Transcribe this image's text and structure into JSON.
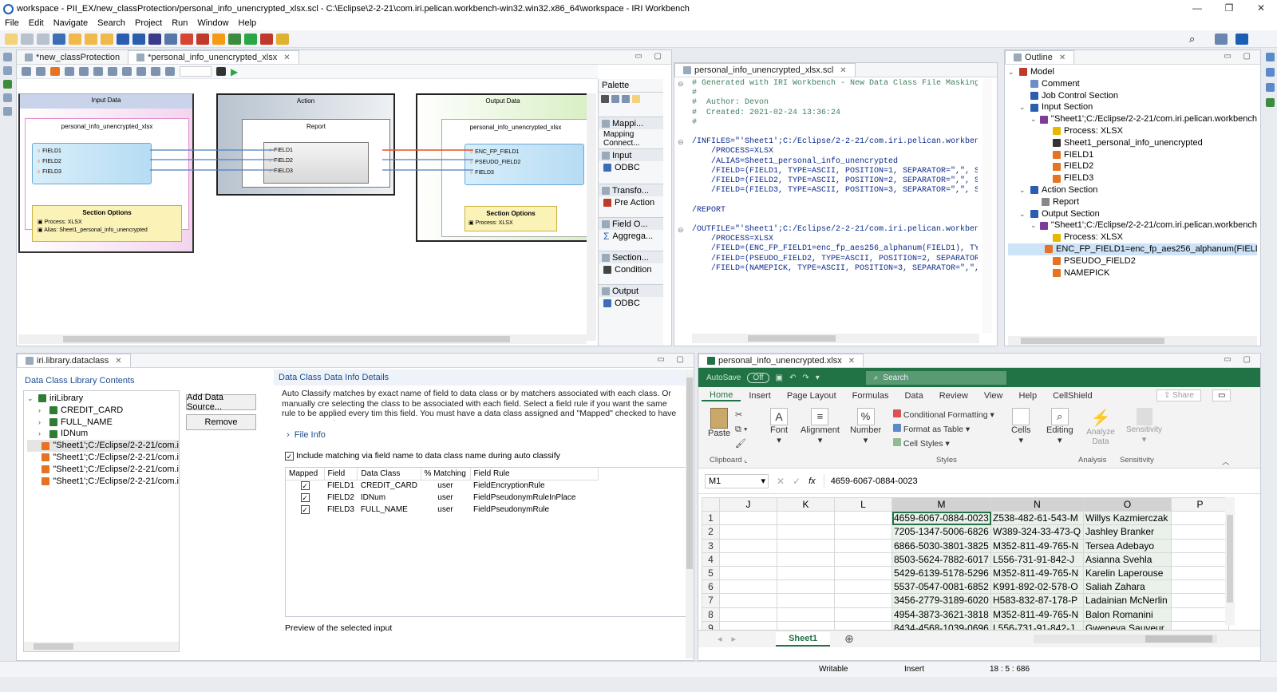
{
  "window": {
    "title": "workspace - PII_EX/new_classProtection/personal_info_unencrypted_xlsx.scl - C:\\Eclipse\\2-2-21\\com.iri.pelican.workbench-win32.win32.x86_64\\workspace - IRI Workbench",
    "minimize": "—",
    "restore": "❐",
    "close": "✕"
  },
  "menu": [
    "File",
    "Edit",
    "Navigate",
    "Search",
    "Project",
    "Run",
    "Window",
    "Help"
  ],
  "diagram": {
    "tabs": [
      "*new_classProtection",
      "*personal_info_unencrypted_xlsx"
    ],
    "input": {
      "header": "Input Data",
      "file": "personal_info_unencrypted_xlsx",
      "fields": [
        "FIELD1",
        "FIELD2",
        "FIELD3"
      ],
      "options_title": "Section Options",
      "options": [
        "Process: XLSX",
        "Alias: Sheet1_personal_info_unencrypted"
      ]
    },
    "action": {
      "header": "Action",
      "name": "Report",
      "fields": [
        "FIELD1",
        "FIELD2",
        "FIELD3"
      ]
    },
    "output": {
      "header": "Output Data",
      "file": "personal_info_unencrypted_xlsx",
      "fields": [
        "ENC_FP_FIELD1",
        "PSEUDO_FIELD2",
        "FIELD3"
      ],
      "options_title": "Section Options",
      "options": [
        "Process: XLSX"
      ]
    },
    "palette": {
      "title": "Palette",
      "groups": [
        {
          "name": "Mappi...",
          "item": "Mapping Connect..."
        },
        {
          "name": "Input",
          "item": "ODBC"
        },
        {
          "name": "Transfo...",
          "item": "Pre Action"
        },
        {
          "name": "Field O...",
          "item": "Aggrega..."
        },
        {
          "name": "Section...",
          "item": "Condition"
        },
        {
          "name": "Output",
          "item": "ODBC"
        }
      ]
    }
  },
  "editor": {
    "tab": "personal_info_unencrypted_xlsx.scl",
    "lines": [
      "# Generated with IRI Workbench - New Data Class File Masking",
      "#",
      "#  Author: Devon",
      "#  Created: 2021-02-24 13:36:24",
      "#",
      "",
      "/INFILES=\"'Sheet1';C:/Eclipse/2-2-21/com.iri.pelican.workbench",
      "    /PROCESS=XLSX",
      "    /ALIAS=Sheet1_personal_info_unencrypted",
      "    /FIELD=(FIELD1, TYPE=ASCII, POSITION=1, SEPARATOR=\",\", SE",
      "    /FIELD=(FIELD2, TYPE=ASCII, POSITION=2, SEPARATOR=\",\", SE",
      "    /FIELD=(FIELD3, TYPE=ASCII, POSITION=3, SEPARATOR=\",\", SE",
      "",
      "/REPORT",
      "",
      "/OUTFILE=\"'Sheet1';C:/Eclipse/2-2-21/com.iri.pelican.workbench",
      "    /PROCESS=XLSX",
      "    /FIELD=(ENC_FP_FIELD1=enc_fp_aes256_alphanum(FIELD1), TYPE",
      "    /FIELD=(PSEUDO_FIELD2, TYPE=ASCII, POSITION=2, SEPARATOR=",
      "    /FIELD=(NAMEPICK, TYPE=ASCII, POSITION=3, SEPARATOR=\",\", S"
    ]
  },
  "outline": {
    "tab": "Outline",
    "items": [
      {
        "label": "Model",
        "indent": 0,
        "color": "#c0392b"
      },
      {
        "label": "Comment",
        "indent": 1,
        "color": "#6d8fc7"
      },
      {
        "label": "Job Control Section",
        "indent": 1,
        "color": "#2a5db0"
      },
      {
        "label": "Input Section",
        "indent": 1,
        "color": "#2a5db0"
      },
      {
        "label": "''Sheet1';C:/Eclipse/2-2-21/com.iri.pelican.workbench",
        "indent": 2,
        "color": "#7d3c98"
      },
      {
        "label": "Process: XLSX",
        "indent": 3,
        "color": "#e6b800"
      },
      {
        "label": "Sheet1_personal_info_unencrypted",
        "indent": 3,
        "color": "#333333"
      },
      {
        "label": "FIELD1",
        "indent": 3,
        "color": "#e67322"
      },
      {
        "label": "FIELD2",
        "indent": 3,
        "color": "#e67322"
      },
      {
        "label": "FIELD3",
        "indent": 3,
        "color": "#e67322"
      },
      {
        "label": "Action Section",
        "indent": 1,
        "color": "#2a5db0"
      },
      {
        "label": "Report",
        "indent": 2,
        "color": "#888888"
      },
      {
        "label": "Output Section",
        "indent": 1,
        "color": "#2a5db0"
      },
      {
        "label": "''Sheet1';C:/Eclipse/2-2-21/com.iri.pelican.workbench",
        "indent": 2,
        "color": "#7d3c98"
      },
      {
        "label": "Process: XLSX",
        "indent": 3,
        "color": "#e6b800"
      },
      {
        "label": "ENC_FP_FIELD1=enc_fp_aes256_alphanum(FIELD1)",
        "indent": 3,
        "color": "#e67322",
        "selected": true
      },
      {
        "label": "PSEUDO_FIELD2",
        "indent": 3,
        "color": "#e67322"
      },
      {
        "label": "NAMEPICK",
        "indent": 3,
        "color": "#e67322"
      }
    ]
  },
  "dataclass": {
    "tab": "iri.library.dataclass",
    "left_title": "Data Class Library Contents",
    "tree": [
      {
        "label": "iriLibrary",
        "indent": 0
      },
      {
        "label": "CREDIT_CARD",
        "indent": 1
      },
      {
        "label": "FULL_NAME",
        "indent": 1
      },
      {
        "label": "IDNum",
        "indent": 1
      },
      {
        "label": "''Sheet1';C:/Eclipse/2-2-21/com.i",
        "indent": 1
      },
      {
        "label": "''Sheet1';C:/Eclipse/2-2-21/com.i",
        "indent": 1
      },
      {
        "label": "''Sheet1';C:/Eclipse/2-2-21/com.i",
        "indent": 1
      },
      {
        "label": "''Sheet1';C:/Eclipse/2-2-21/com.i",
        "indent": 1
      }
    ],
    "add_button": "Add Data Source...",
    "remove_button": "Remove",
    "right_title": "Data Class Data Info Details",
    "description": "Auto Classify matches by exact name of field to data class or by matchers associated with each class. Or manually cre selecting the class to be associated with each field. Select a field rule if you want the same rule to be applied every tim this field. You must have a data class assigned and \"Mapped\" checked to have a map created.",
    "file_info": "File Info",
    "include_label": "Include matching via field name to data class name during auto classify",
    "columns": [
      "Mapped",
      "Field",
      "Data Class",
      "% Matching",
      "Field Rule"
    ],
    "rows": [
      [
        "FIELD1",
        "CREDIT_CARD",
        "user",
        "FieldEncryptionRule"
      ],
      [
        "FIELD2",
        "IDNum",
        "user",
        "FieldPseudonymRuleInPlace"
      ],
      [
        "FIELD3",
        "FULL_NAME",
        "user",
        "FieldPseudonymRule"
      ]
    ],
    "preview": "Preview of the selected input"
  },
  "excel": {
    "tab": "personal_info_unencrypted.xlsx",
    "autosave": "AutoSave",
    "autosave_state": "Off",
    "search": "Search",
    "ribbon_tabs": [
      "Home",
      "Insert",
      "Page Layout",
      "Formulas",
      "Data",
      "Review",
      "View",
      "Help",
      "CellShield"
    ],
    "share": "Share",
    "groups": {
      "paste": "Paste",
      "font": "Font",
      "alignment": "Alignment",
      "number": "Number",
      "cond": "Conditional Formatting",
      "table": "Format as Table",
      "styles": "Cell Styles",
      "cells": "Cells",
      "editing": "Editing",
      "analyze": "Analyze Data",
      "sensitivity": "Sensitivity",
      "clipboard": "Clipboard",
      "styles_group": "Styles",
      "analysis": "Analysis",
      "sensitivity_group": "Sensitivity"
    },
    "namebox": "M1",
    "formula": "4659-6067-0884-0023",
    "fx": "fx",
    "columns": [
      "J",
      "K",
      "L",
      "M",
      "N",
      "O",
      "P"
    ],
    "rows": [
      [
        "4659-6067-0884-0023",
        "Z538-482-61-543-M",
        "Willys Kazmierczak"
      ],
      [
        "7205-1347-5006-6826",
        "W389-324-33-473-Q",
        "Jashley Branker"
      ],
      [
        "6866-5030-3801-3825",
        "M352-811-49-765-N",
        "Tersea Adebayo"
      ],
      [
        "8503-5624-7882-6017",
        "L556-731-91-842-J",
        "Asianna Svehla"
      ],
      [
        "5429-6139-5178-5296",
        "M352-811-49-765-N",
        "Karelin Laperouse"
      ],
      [
        "5537-0547-0081-6852",
        "K991-892-02-578-O",
        "Saliah Zahara"
      ],
      [
        "3456-2779-3189-6020",
        "H583-832-87-178-P",
        "Ladainian McNerlin"
      ],
      [
        "4954-3873-3621-3818",
        "M352-811-49-765-N",
        "Balon Romanini"
      ],
      [
        "8434-4568-1039-0696",
        "L556-731-91-842-J",
        "Gweneva Sauveur"
      ]
    ],
    "sheet": "Sheet1"
  },
  "status": {
    "mode": "Writable",
    "insert": "Insert",
    "position": "18 : 5 : 686"
  },
  "colors": {
    "accent": "#1f4d8f",
    "excel": "#217346",
    "orange": "#e67322",
    "selection": "#cde3f7"
  }
}
